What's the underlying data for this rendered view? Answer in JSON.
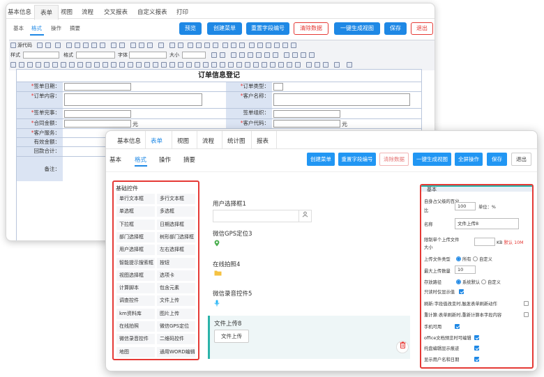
{
  "back": {
    "top_tabs": [
      "基本信息",
      "表单",
      "视图",
      "流程",
      "交叉报表",
      "自定义报表",
      "打印"
    ],
    "sub_tabs": [
      "基本",
      "格式",
      "操作",
      "摘要"
    ],
    "buttons": {
      "preview": "预览",
      "create_menu": "创建菜单",
      "reset_field_no": "重置字段编号",
      "clear_data": "清除数据",
      "one_click_view": "一键生成视图",
      "save": "保存",
      "exit": "退出"
    },
    "toolbar": {
      "source": "源代码",
      "style": "样式",
      "format": "格式",
      "font": "字体",
      "size": "大小"
    },
    "form": {
      "title": "订单信息登记",
      "labels": {
        "sign_date": "签单日期",
        "order_content": "订单内容",
        "sign_owner": "签单完事",
        "contract_amount": "合同金额",
        "customer_service": "客户服务",
        "valid_amount": "有效金额",
        "refund_total": "回款合计",
        "remark": "备注",
        "order_type": "订单类型",
        "customer_name": "客户名称",
        "sign_org": "签单组织",
        "customer_code": "客户代码"
      },
      "unit": "元"
    }
  },
  "front": {
    "top_tabs": [
      "基本信息",
      "表单",
      "视图",
      "流程",
      "统计图",
      "报表"
    ],
    "sub_tabs": [
      "基本",
      "格式",
      "操作",
      "摘要"
    ],
    "buttons": {
      "create_menu": "创建菜单",
      "reset_field_no": "重置字段编号",
      "clear_data": "清除数据",
      "one_click_view": "一键生成视图",
      "full_op": "全屏操作",
      "save": "保存",
      "exit": "退出"
    },
    "palette": {
      "title": "基础控件",
      "items": [
        "单行文本框",
        "多行文本框",
        "单选框",
        "多选框",
        "下拉框",
        "日期选择框",
        "部门选择框",
        "树形部门选择框",
        "用户选择框",
        "左右选择框",
        "智能提示搜索框",
        "按钮",
        "视图选择框",
        "选项卡",
        "计算脚本",
        "包含元素",
        "调查控件",
        "文件上传",
        "km资料库",
        "图片上传",
        "在线拍照",
        "微信GPS定位",
        "微信录音控件",
        "二维码控件",
        "地图",
        "通用WORD编辑器"
      ]
    },
    "canvas": {
      "user_select": "用户选择框1",
      "gps": "微信GPS定位3",
      "photo": "在线拍照4",
      "record": "微信录音控件5",
      "upload": "文件上传8",
      "upload_button": "文件上传"
    },
    "props": {
      "title": "基本",
      "width_label_1": "自身占父级的百分",
      "width_label_2": "比",
      "width_value": "100",
      "width_unit": "单位：%",
      "name_label": "名称",
      "name_value": "文件上传8",
      "limit_label_1": "限制单个上传文件",
      "limit_label_2": "大小",
      "limit_unit": "KB",
      "limit_default": "默认 10M",
      "type_label": "上传文件类型",
      "type_all": "所有",
      "type_custom": "自定义",
      "max_label": "最大上传数量",
      "max_value": "10",
      "path_label": "存放路径",
      "path_default": "系统默认",
      "path_custom": "自定义",
      "chk": [
        {
          "label": "只读时仅显示值",
          "checked": true
        },
        {
          "label": "刷新:字段值改变时,触发表单刷新动作",
          "checked": false
        },
        {
          "label": "重计算:表单刷新时,重新计算本字段内容",
          "checked": false
        },
        {
          "label": "手机可用",
          "checked": true
        },
        {
          "label": "office文档预览时可编辑",
          "checked": true
        },
        {
          "label": "托盘编辑显示痕迹",
          "checked": true
        },
        {
          "label": "显示用户名和日期",
          "checked": true
        }
      ]
    }
  }
}
